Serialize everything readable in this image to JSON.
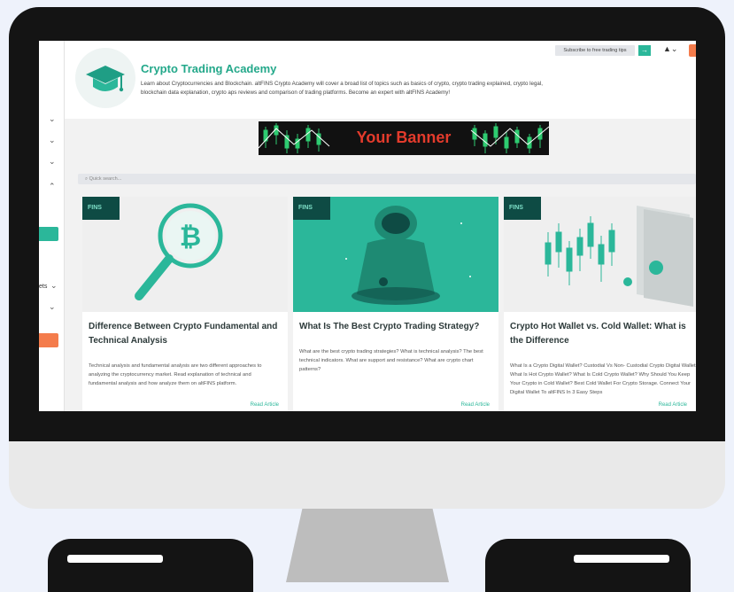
{
  "header": {
    "title": "Crypto Trading Academy",
    "description": "Learn about Cryptocurrencies and Blockchain. altFINS Crypto Academy will cover a broad list of topics such as basics of crypto, crypto trading explained, crypto legal, blockchain data explanation, crypto aps reviews and comparison of trading platforms. Become an expert with altFINS Academy!",
    "subscribe_label": "Subscribe to free trading tips",
    "arrow_label": "→"
  },
  "sidebar": {
    "partial_label": "ets"
  },
  "banner": {
    "text": "Your Banner"
  },
  "search": {
    "placeholder": "Quick search..."
  },
  "cards": [
    {
      "badge": "FINS",
      "title": "Difference Between Crypto Fundamental and Technical Analysis",
      "description": "Technical analysis and fundamental analysis are two different approaches to analyzing the cryptocurrency market. Read explanation of technical and fundamental analysis and how analyze them on altFINS platform.",
      "link": "Read Article"
    },
    {
      "badge": "FINS",
      "title": "What Is The Best Crypto Trading Strategy?",
      "description": "What are the best crypto trading strategies? What is technical analysis? The best technical indicators. What are support and resistance? What are crypto chart patterns?",
      "link": "Read Article"
    },
    {
      "badge": "FINS",
      "title": "Crypto Hot Wallet vs. Cold Wallet: What is the Difference",
      "description": "What Is a Crypto Digital Wallet? Custodial Vs Non- Custodial Crypto Digital Wallets. What Is Hot Crypto Wallet? What Is Cold Crypto Wallet? Why Should You Keep Your Crypto in Cold Wallet? Best Cold Wallet For Crypto Storage. Connect Your Digital Wallet To altFINS In 3 Easy Steps",
      "link": "Read Article"
    }
  ],
  "colors": {
    "accent": "#2bb79a",
    "orange": "#f47c4c",
    "badge_bg": "#0e4b44"
  }
}
